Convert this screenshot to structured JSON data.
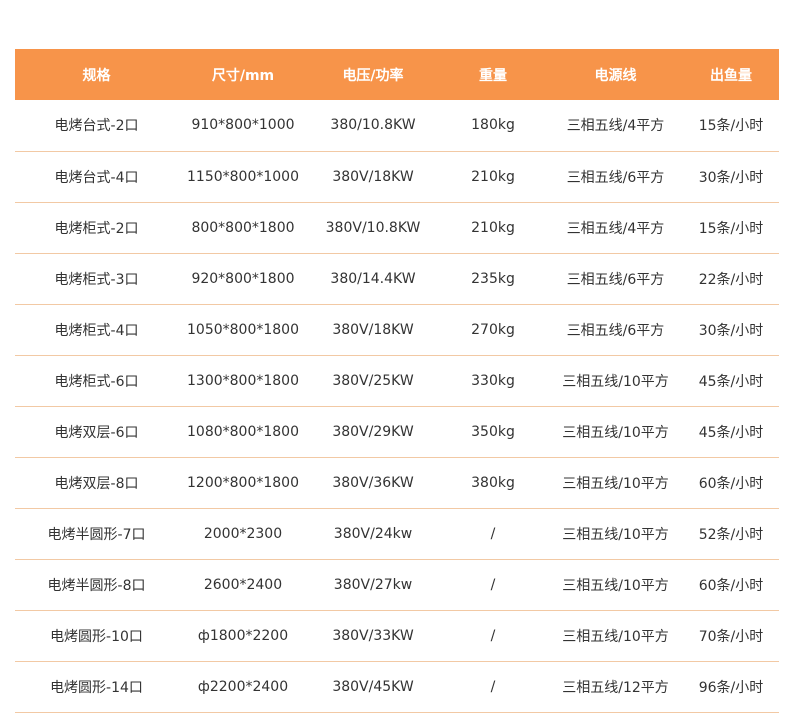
{
  "table": {
    "headers": [
      "规格",
      "尺寸/mm",
      "电压/功率",
      "重量",
      "电源线",
      "出鱼量"
    ],
    "rows": [
      [
        "电烤台式-2口",
        "910*800*1000",
        "380/10.8KW",
        "180kg",
        "三相五线/4平方",
        "15条/小时"
      ],
      [
        "电烤台式-4口",
        "1150*800*1000",
        "380V/18KW",
        "210kg",
        "三相五线/6平方",
        "30条/小时"
      ],
      [
        "电烤柜式-2口",
        "800*800*1800",
        "380V/10.8KW",
        "210kg",
        "三相五线/4平方",
        "15条/小时"
      ],
      [
        "电烤柜式-3口",
        "920*800*1800",
        "380/14.4KW",
        "235kg",
        "三相五线/6平方",
        "22条/小时"
      ],
      [
        "电烤柜式-4口",
        "1050*800*1800",
        "380V/18KW",
        "270kg",
        "三相五线/6平方",
        "30条/小时"
      ],
      [
        "电烤柜式-6口",
        "1300*800*1800",
        "380V/25KW",
        "330kg",
        "三相五线/10平方",
        "45条/小时"
      ],
      [
        "电烤双层-6口",
        "1080*800*1800",
        "380V/29KW",
        "350kg",
        "三相五线/10平方",
        "45条/小时"
      ],
      [
        "电烤双层-8口",
        "1200*800*1800",
        "380V/36KW",
        "380kg",
        "三相五线/10平方",
        "60条/小时"
      ],
      [
        "电烤半圆形-7口",
        "2000*2300",
        "380V/24kw",
        "/",
        "三相五线/10平方",
        "52条/小时"
      ],
      [
        "电烤半圆形-8口",
        "2600*2400",
        "380V/27kw",
        "/",
        "三相五线/10平方",
        "60条/小时"
      ],
      [
        "电烤圆形-10口",
        "ф1800*2200",
        "380V/33KW",
        "/",
        "三相五线/10平方",
        "70条/小时"
      ],
      [
        "电烤圆形-14口",
        "ф2200*2400",
        "380V/45KW",
        "/",
        "三相五线/12平方",
        "96条/小时"
      ]
    ]
  },
  "colors": {
    "header_bg": "#f7944a",
    "header_text": "#ffffff",
    "row_divider": "#f2c9a4",
    "cell_text": "#333333"
  }
}
